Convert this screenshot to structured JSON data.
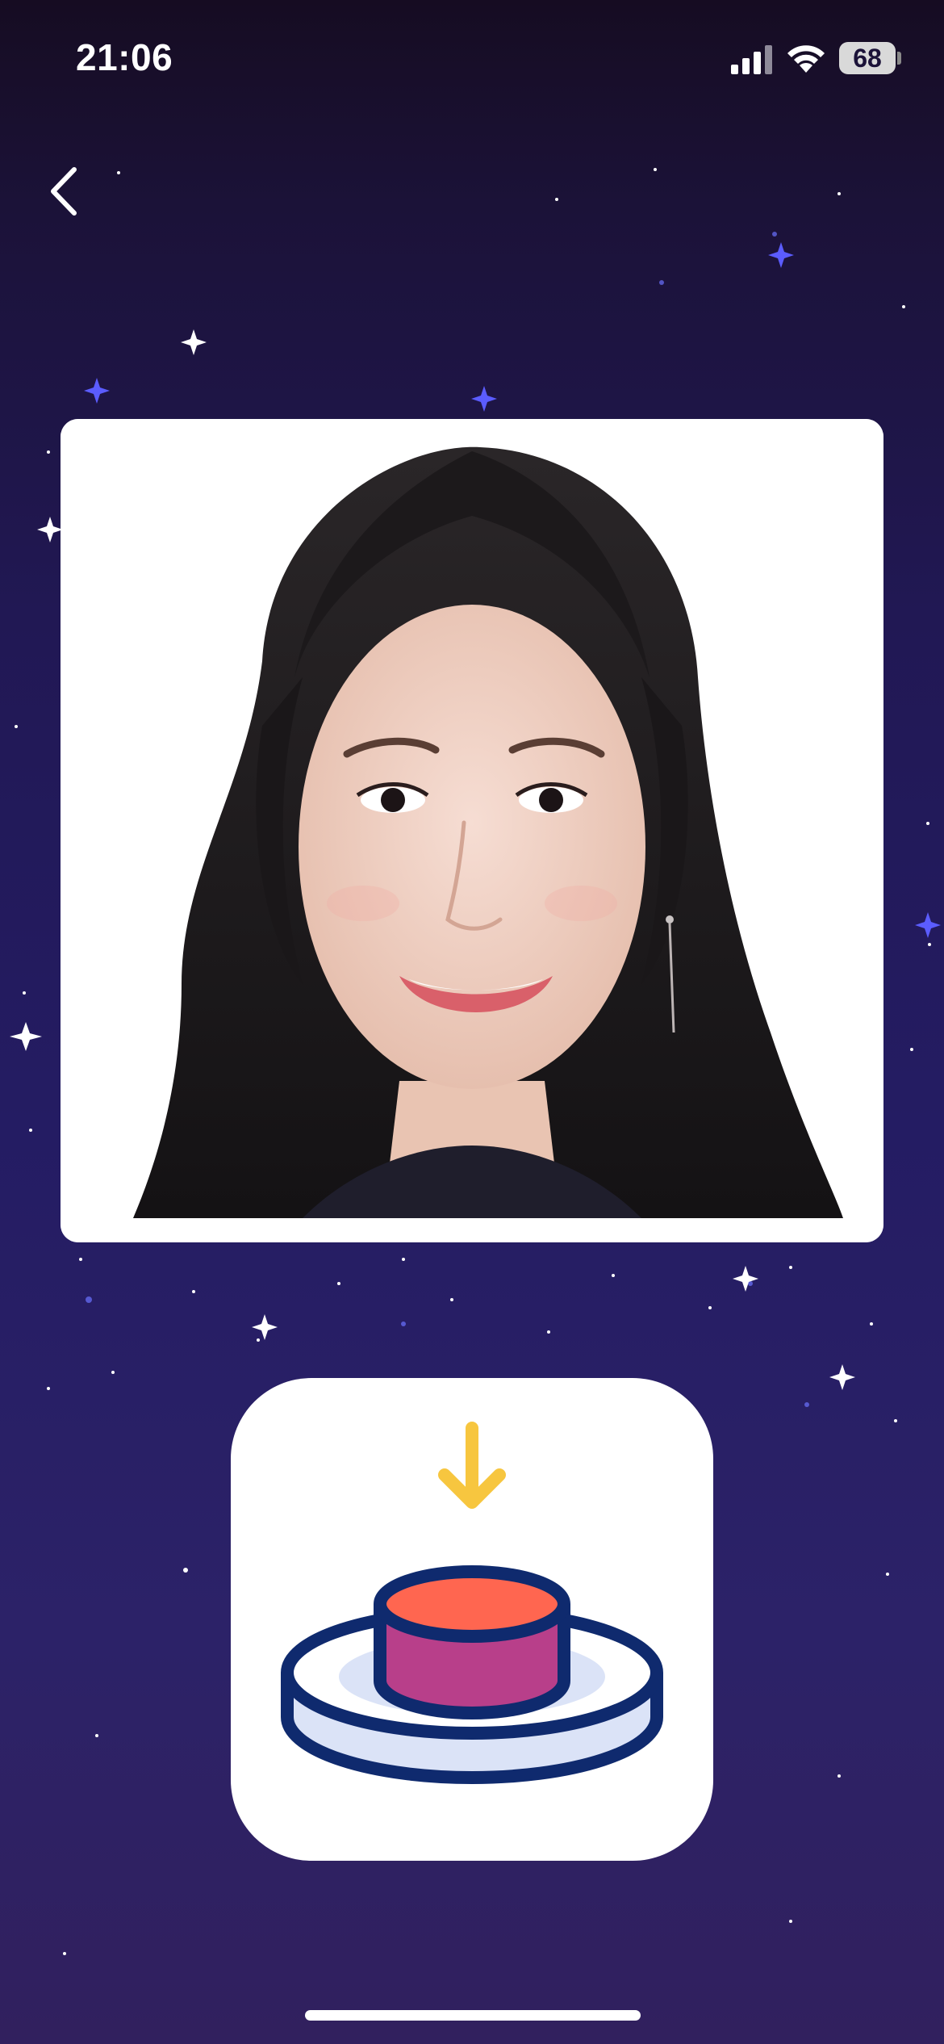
{
  "status_bar": {
    "time": "21:06",
    "battery_level": "68",
    "signal_icon": "cellular-signal-icon",
    "wifi_icon": "wifi-icon",
    "battery_icon": "battery-icon"
  },
  "navigation": {
    "back_icon": "chevron-left-icon"
  },
  "photo": {
    "subject": "portrait-photo"
  },
  "action_tile": {
    "icon": "push-button-icon"
  },
  "colors": {
    "background_top": "#160c22",
    "background_bottom": "#31205e",
    "card_background": "#ffffff",
    "icon_outline": "#0f2a6e",
    "button_top": "#ff6650",
    "button_side": "#b83f8a",
    "base_fill": "#dbe3f7",
    "arrow": "#f7c63f"
  }
}
